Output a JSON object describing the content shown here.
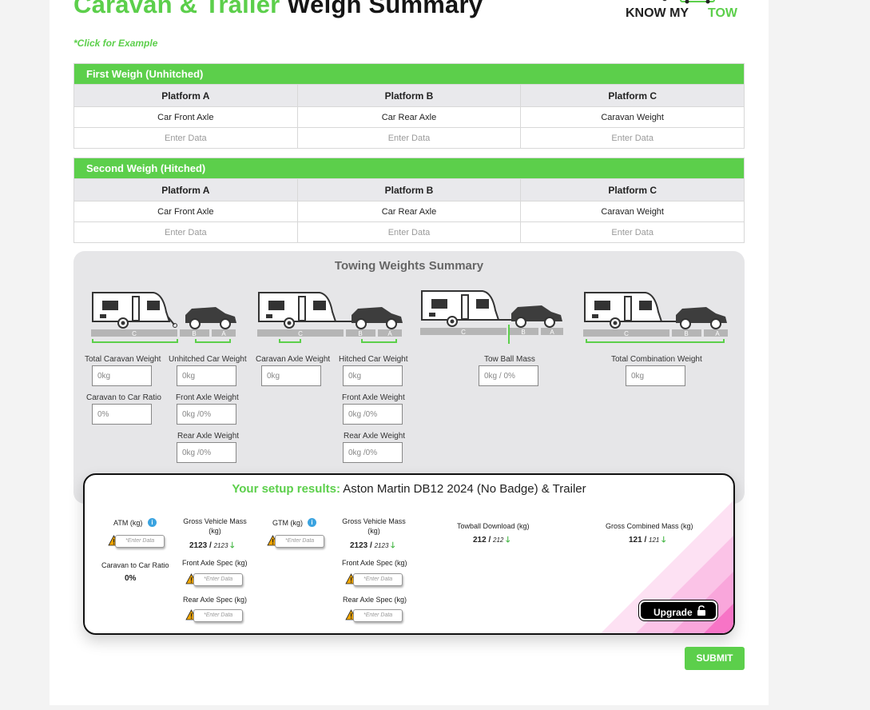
{
  "header": {
    "title_green": "Caravan & Trailer",
    "title_dark": "Weigh Summary",
    "logo_text_a": "KNOW MY",
    "logo_text_b": "TOW",
    "example_link": "*Click for Example"
  },
  "first_weigh": {
    "title": "First Weigh (Unhitched)",
    "columns": [
      "Platform A",
      "Platform B",
      "Platform C"
    ],
    "labels": [
      "Car Front Axle",
      "Car Rear Axle",
      "Caravan Weight"
    ],
    "placeholders": [
      "Enter Data",
      "Enter Data",
      "Enter Data"
    ]
  },
  "second_weigh": {
    "title": "Second Weigh (Hitched)",
    "columns": [
      "Platform A",
      "Platform B",
      "Platform C"
    ],
    "labels": [
      "Car Front Axle",
      "Car Rear Axle",
      "Caravan Weight"
    ],
    "placeholders": [
      "Enter Data",
      "Enter Data",
      "Enter Data"
    ]
  },
  "towing_summary": {
    "title": "Towing Weights Summary",
    "platform_letters": [
      "C",
      "B",
      "A"
    ],
    "fields": {
      "total_caravan_weight": {
        "label": "Total Caravan Weight",
        "value": "0kg"
      },
      "caravan_to_car_ratio": {
        "label": "Caravan to Car Ratio",
        "value": "0%"
      },
      "unhitched_car_weight": {
        "label": "Unhitched Car Weight",
        "value": "0kg"
      },
      "unhitched_front_axle": {
        "label": "Front Axle Weight",
        "value": "0kg /0%"
      },
      "unhitched_rear_axle": {
        "label": "Rear Axle Weight",
        "value": "0kg /0%"
      },
      "caravan_axle_weight": {
        "label": "Caravan Axle Weight",
        "value": "0kg"
      },
      "hitched_car_weight": {
        "label": "Hitched Car Weight",
        "value": "0kg"
      },
      "hitched_front_axle": {
        "label": "Front Axle Weight",
        "value": "0kg /0%"
      },
      "hitched_rear_axle": {
        "label": "Rear Axle Weight",
        "value": "0kg /0%"
      },
      "tow_ball_mass": {
        "label": "Tow Ball Mass",
        "value": "0kg / 0%"
      },
      "total_combination_weight": {
        "label": "Total Combination Weight",
        "value": "0kg"
      }
    }
  },
  "results": {
    "heading_green": "Your setup results:",
    "heading_vehicle": "Aston Martin DB12 2024 (No Badge) & Trailer",
    "enter_data": "*Enter Data",
    "atm_label": "ATM (kg)",
    "caravan_ratio_label": "Caravan to Car Ratio",
    "caravan_ratio_value": "0%",
    "gvm_label_1": "Gross Vehicle Mass (kg)",
    "gvm_value_1": "2123",
    "gvm_spec_1": "2123",
    "front_axle_spec_1": "Front Axle Spec (kg)",
    "rear_axle_spec_1": "Rear Axle Spec (kg)",
    "gtm_label": "GTM (kg)",
    "gvm_label_2": "Gross Vehicle Mass (kg)",
    "gvm_value_2": "2123",
    "gvm_spec_2": "2123",
    "front_axle_spec_2": "Front Axle Spec (kg)",
    "rear_axle_spec_2": "Rear Axle Spec (kg)",
    "towball_label": "Towball Download (kg)",
    "towball_value": "212",
    "towball_spec": "212",
    "gcm_label": "Gross Combined Mass (kg)",
    "gcm_value": "121",
    "gcm_spec": "121",
    "separator": "/",
    "arrow": "🡓",
    "info": "i",
    "upgrade_label": "Upgrade"
  },
  "submit_label": "SUBMIT",
  "colors": {
    "accent": "#5ccf4b",
    "info": "#3aa3e0",
    "warning": "#f0a500",
    "pink": "#f774c6"
  }
}
